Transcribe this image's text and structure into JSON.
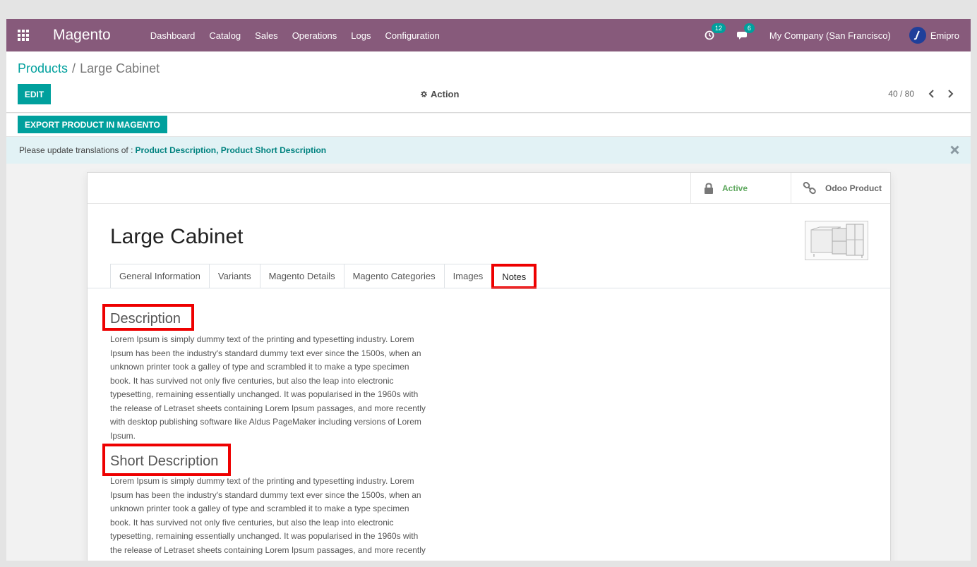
{
  "navbar": {
    "brand": "Magento",
    "menu": [
      "Dashboard",
      "Catalog",
      "Sales",
      "Operations",
      "Logs",
      "Configuration"
    ],
    "activity_count": "12",
    "message_count": "6",
    "company": "My Company (San Francisco)",
    "user": "Emipro"
  },
  "breadcrumb": {
    "parent": "Products",
    "separator": "/",
    "current": "Large Cabinet"
  },
  "control": {
    "edit_label": "EDIT",
    "action_label": "Action",
    "pager": "40 / 80"
  },
  "header": {
    "export_label": "EXPORT PRODUCT IN MAGENTO"
  },
  "alert": {
    "prefix": "Please update translations of :",
    "fields": "Product Description, Product Short Description"
  },
  "stats": {
    "active_label": "Active",
    "odoo_label": "Odoo Product"
  },
  "product": {
    "name": "Large Cabinet"
  },
  "tabs": [
    "General Information",
    "Variants",
    "Magento Details",
    "Magento Categories",
    "Images",
    "Notes"
  ],
  "notes": {
    "description_title": "Description",
    "description_lines": [
      "Lorem Ipsum is simply dummy text of the printing and typesetting industry. Lorem",
      "Ipsum has been the industry's standard dummy text ever since the 1500s, when an",
      "unknown printer took a galley of type and scrambled it to make a type specimen",
      "book. It has survived not only five centuries, but also the leap into electronic",
      "typesetting, remaining essentially unchanged. It was popularised in the 1960s with",
      "the release of Letraset sheets containing Lorem Ipsum passages, and more recently",
      "with desktop publishing software like Aldus PageMaker including versions of Lorem",
      "Ipsum."
    ],
    "short_title": "Short Description",
    "short_lines": [
      "Lorem Ipsum is simply dummy text of the printing and typesetting industry. Lorem",
      "Ipsum has been the industry's standard dummy text ever since the 1500s, when an",
      "unknown printer took a galley of type and scrambled it to make a type specimen",
      "book. It has survived not only five centuries, but also the leap into electronic",
      "typesetting, remaining essentially unchanged. It was popularised in the 1960s with",
      "the release of Letraset sheets containing Lorem Ipsum passages, and more recently"
    ]
  },
  "colors": {
    "navbar": "#875a7b",
    "primary": "#00a09d",
    "highlight": "#ee0000",
    "active_green": "#5fa85f"
  },
  "icons": [
    "apps-grid-icon",
    "clock-icon",
    "chat-icon",
    "gear-icon",
    "chevron-left-icon",
    "chevron-right-icon",
    "close-icon",
    "lock-icon",
    "link-icon"
  ]
}
